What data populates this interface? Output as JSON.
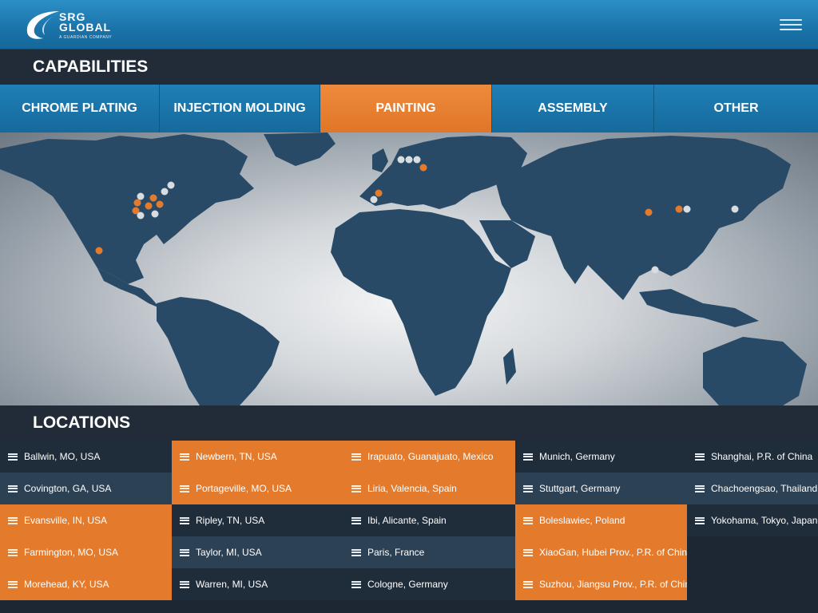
{
  "header": {
    "logo_line1": "SRG",
    "logo_line2": "GLOBAL",
    "logo_tagline": "A GUARDIAN COMPANY",
    "menu_icon": "hamburger-menu-icon"
  },
  "capabilities": {
    "title": "CAPABILITIES",
    "tabs": [
      {
        "label": "CHROME PLATING",
        "active": false
      },
      {
        "label": "INJECTION MOLDING",
        "active": false
      },
      {
        "label": "PAINTING",
        "active": true
      },
      {
        "label": "ASSEMBLY",
        "active": false
      },
      {
        "label": "OTHER",
        "active": false
      }
    ]
  },
  "colors": {
    "accent_orange": "#e47b2c",
    "brand_blue": "#1a73a8",
    "map_land": "#284a66",
    "marker_inactive": "#d8dde2"
  },
  "locations": {
    "title": "LOCATIONS",
    "columns": [
      [
        {
          "name": "Ballwin, MO, USA",
          "highlight": false
        },
        {
          "name": "Covington, GA, USA",
          "highlight": false
        },
        {
          "name": "Evansville, IN, USA",
          "highlight": true
        },
        {
          "name": "Farmington, MO, USA",
          "highlight": true
        },
        {
          "name": "Morehead, KY, USA",
          "highlight": true
        }
      ],
      [
        {
          "name": "Newbern, TN, USA",
          "highlight": true
        },
        {
          "name": "Portageville, MO, USA",
          "highlight": true
        },
        {
          "name": "Ripley, TN, USA",
          "highlight": false
        },
        {
          "name": "Taylor, MI, USA",
          "highlight": false
        },
        {
          "name": "Warren, MI, USA",
          "highlight": false
        }
      ],
      [
        {
          "name": "Irapuato, Guanajuato, Mexico",
          "highlight": true
        },
        {
          "name": "Liria, Valencia, Spain",
          "highlight": true
        },
        {
          "name": "Ibi, Alicante, Spain",
          "highlight": false
        },
        {
          "name": "Paris, France",
          "highlight": false
        },
        {
          "name": "Cologne, Germany",
          "highlight": false
        }
      ],
      [
        {
          "name": "Munich, Germany",
          "highlight": false
        },
        {
          "name": "Stuttgart, Germany",
          "highlight": false
        },
        {
          "name": "Boleslawiec, Poland",
          "highlight": true
        },
        {
          "name": "XiaoGan, Hubei Prov., P.R. of China",
          "highlight": true
        },
        {
          "name": "Suzhou, Jiangsu Prov., P.R. of China",
          "highlight": true
        }
      ],
      [
        {
          "name": "Shanghai, P.R. of China",
          "highlight": false
        },
        {
          "name": "Chachoengsao, Thailand",
          "highlight": false
        },
        {
          "name": "Yokohama, Tokyo, Japan",
          "highlight": false
        }
      ]
    ]
  }
}
